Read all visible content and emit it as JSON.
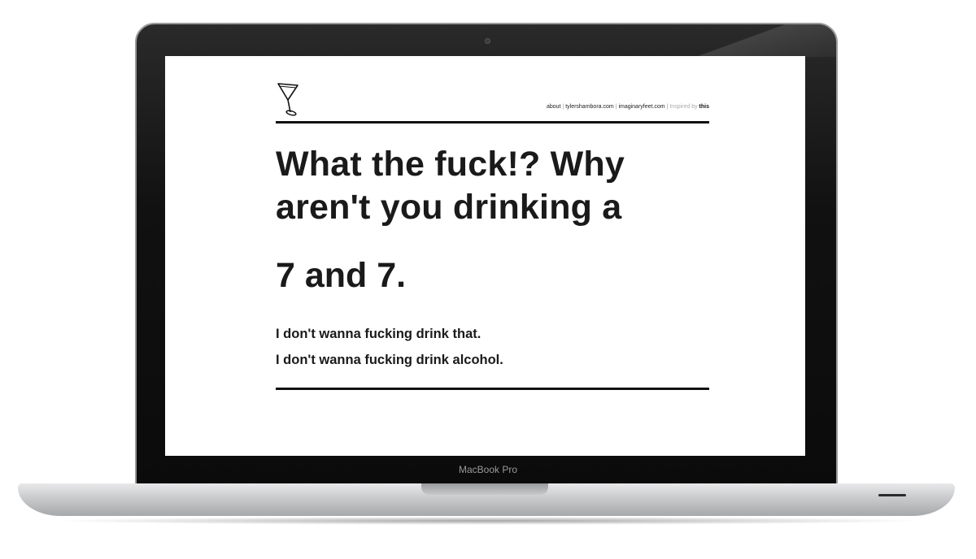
{
  "device": {
    "label": "MacBook Pro"
  },
  "nav": {
    "about": "about",
    "site1": "tylershambora.com",
    "site2": "imaginaryfeet.com",
    "inspired_prefix": "Inspired by",
    "inspired_link": "this",
    "separator": "|"
  },
  "main": {
    "headline": "What the fuck!? Why aren't you drinking a",
    "drink": "7 and 7.",
    "reply_1": "I don't wanna fucking drink that.",
    "reply_2": "I don't wanna fucking drink alcohol."
  },
  "icons": {
    "logo": "martini-glass-icon"
  }
}
